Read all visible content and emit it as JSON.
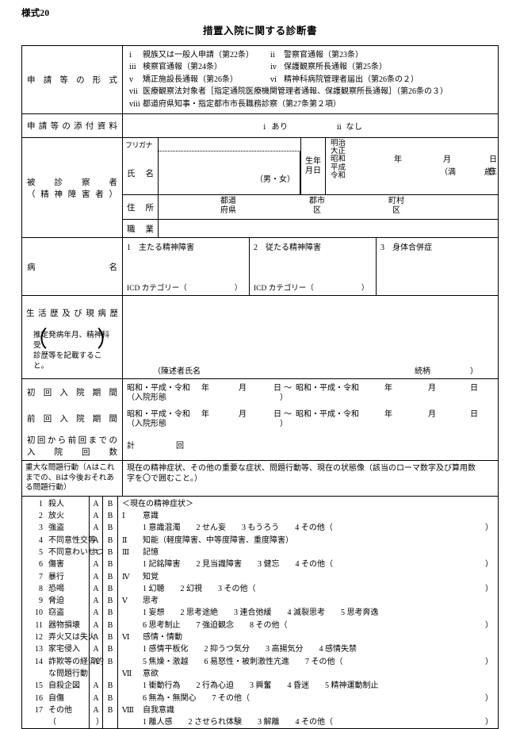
{
  "header": {
    "form_no": "様式20",
    "title": "措置入院に関する診断書"
  },
  "application": {
    "label": "申請等の形式",
    "items": [
      {
        "numeral": "ⅰ",
        "text": "親族又は一般人申請（第22条）"
      },
      {
        "numeral": "ⅱ",
        "text": "警察官通報（第23条）"
      },
      {
        "numeral": "ⅲ",
        "text": "検察官通報（第24条）"
      },
      {
        "numeral": "ⅳ",
        "text": "保護観察所長通報（第25条）"
      },
      {
        "numeral": "ⅴ",
        "text": "矯正施設長通報（第26条）"
      },
      {
        "numeral": "ⅵ",
        "text": "精神科病院管理者届出（第26条の２）"
      },
      {
        "numeral": "ⅶ",
        "text": "医療観察法対象者［指定通院医療機関管理者通報、保護観察所長通報］（第26条の３）"
      },
      {
        "numeral": "ⅷ",
        "text": "都道府県知事・指定都市市長職務診察（第27条第２項）"
      }
    ]
  },
  "attachment": {
    "label": "申請等の添付資料",
    "option_yes_numeral": "ⅰ",
    "option_yes": "あり",
    "option_no_numeral": "ⅱ",
    "option_no": "なし"
  },
  "patient": {
    "label_line1": "被診察者",
    "label_line2": "（精神障害者）",
    "furigana_label": "フリガナ",
    "name_label": "氏名",
    "sex_note": "（男・女）",
    "dob_label_l1": "生年",
    "dob_label_l2": "月日",
    "eras": [
      "明治",
      "大正",
      "昭和",
      "平成",
      "令和"
    ],
    "year": "年",
    "month": "月",
    "day": "日生",
    "age_open": "（満",
    "age_close": "歳）",
    "address_label": "住所",
    "addr_pref_l1": "都道",
    "addr_pref_l2": "府県",
    "addr_city_l1": "郡市",
    "addr_city_l2": "区",
    "addr_town_l1": "町村",
    "addr_town_l2": "区",
    "occupation_label": "職業"
  },
  "disease": {
    "label": "病名",
    "col1": "1　主たる精神障害",
    "col2": "2　従たる精神障害",
    "col3": "3　身体合併症",
    "icd_label": "ICD カテゴリー（",
    "icd_close": "）"
  },
  "history": {
    "label": "生活歴及び現病歴",
    "note_l1": "推定発病年月、精神科受",
    "note_l2": "診歴等を記載すること。",
    "bracket_left": "（",
    "bracket_right": "）",
    "statement_label": "（陳述者氏名",
    "relation_label": "続柄",
    "close_paren": "）"
  },
  "admission": {
    "first_label": "初回入院期間",
    "prev_label": "前回入院期間",
    "count_label_l1": "初回から前回までの",
    "count_label_l2": "入院回数",
    "eras": "昭和・平成・令和",
    "year": "年",
    "month": "月",
    "day": "日",
    "tilde": "～",
    "form_open": "（入院形態",
    "form_close": "）",
    "total_prefix": "計",
    "total_suffix": "回"
  },
  "serious": {
    "label_l1": "重大な問題行動（Aはこれ",
    "label_l2": "までの、Bは今後おそれあ",
    "label_l3": "る問題行動）",
    "instruction_l1": "現在の精神症状、その他の重要な症状、問題行動等、現在の状態像（該当のローマ数字及び算用数",
    "instruction_l2": "字を〇で囲むこと。）",
    "col_a": "A",
    "col_b": "B",
    "behaviors": [
      {
        "num": "1",
        "text": "殺人",
        "ab": true
      },
      {
        "num": "2",
        "text": "放火",
        "ab": true
      },
      {
        "num": "3",
        "text": "強盗",
        "ab": true
      },
      {
        "num": "4",
        "text": "不同意性交等",
        "ab": true
      },
      {
        "num": "5",
        "text": "不同意わいせつ",
        "ab": true
      },
      {
        "num": "6",
        "text": "傷害",
        "ab": true
      },
      {
        "num": "7",
        "text": "暴行",
        "ab": true
      },
      {
        "num": "8",
        "text": "恐喝",
        "ab": true
      },
      {
        "num": "9",
        "text": "脅迫",
        "ab": true
      },
      {
        "num": "10",
        "text": "窃盗",
        "ab": true
      },
      {
        "num": "11",
        "text": "器物損壊",
        "ab": true
      },
      {
        "num": "12",
        "text": "弄火又は失火",
        "ab": true
      },
      {
        "num": "13",
        "text": "家宅侵入",
        "ab": true
      },
      {
        "num": "14",
        "text": "詐欺等の経済的",
        "ab": true
      },
      {
        "num": "",
        "text": "な問題行動",
        "ab": false
      },
      {
        "num": "15",
        "text": "自殺企図",
        "ab": true
      },
      {
        "num": "16",
        "text": "自傷",
        "ab": true
      },
      {
        "num": "17",
        "text": "その他",
        "ab": true
      },
      {
        "num": "",
        "text": "（　　　　　）",
        "ab": false
      }
    ]
  },
  "symptoms": {
    "heading": "＜現在の精神症状＞",
    "lines": [
      {
        "roman": "Ⅰ",
        "text": "意識",
        "close": ""
      },
      {
        "roman": "",
        "text": "1 意識混濁　　2 せん妄　　3 もうろう　　4 その他（",
        "close": "）"
      },
      {
        "roman": "Ⅱ",
        "text": "知能（軽度障害、中等度障害、重度障害）",
        "close": ""
      },
      {
        "roman": "Ⅲ",
        "text": "記憶",
        "close": ""
      },
      {
        "roman": "",
        "text": "1 記銘障害　　2 見当識障害　　3 健忘　　4 その他（",
        "close": "）"
      },
      {
        "roman": "Ⅳ",
        "text": "知覚",
        "close": ""
      },
      {
        "roman": "",
        "text": "1 幻聴　　2 幻視　　3 その他（",
        "close": "）"
      },
      {
        "roman": "Ⅴ",
        "text": "思考",
        "close": ""
      },
      {
        "roman": "",
        "text": "1 妄想　　2 思考途絶　　3 連合弛緩　　4 滅裂思考　　5 思考奔逸",
        "close": ""
      },
      {
        "roman": "",
        "text": "6 思考制止　　7 強迫観念　　8 その他（",
        "close": "）"
      },
      {
        "roman": "Ⅵ",
        "text": "感情・情動",
        "close": ""
      },
      {
        "roman": "",
        "text": "1 感情平板化　　2 抑うつ気分　　3 高揚気分　　4 感情失禁",
        "close": ""
      },
      {
        "roman": "",
        "text": "5 焦燥・激越　　6 易怒性・被刺激性亢進　　7 その他（",
        "close": "）"
      },
      {
        "roman": "Ⅶ",
        "text": "意欲",
        "close": ""
      },
      {
        "roman": "",
        "text": "1 衝動行為　　2 行為心迫　　3 興奮　　4 昏迷　　5 精神運動制止",
        "close": ""
      },
      {
        "roman": "",
        "text": "6 無為・無関心　　7 その他（",
        "close": "）"
      },
      {
        "roman": "Ⅷ",
        "text": "自我意識",
        "close": ""
      },
      {
        "roman": "",
        "text": "1 離人感　　2 させられ体験　　3 解離　　4 その他（",
        "close": "）"
      }
    ]
  }
}
